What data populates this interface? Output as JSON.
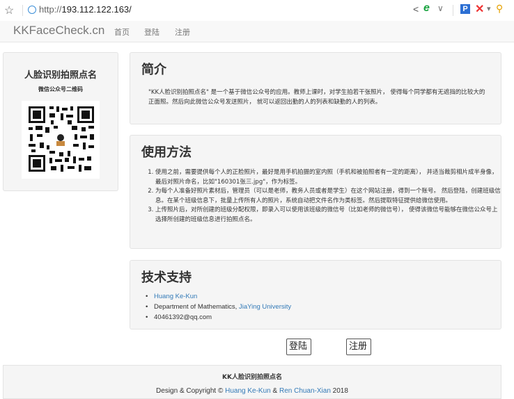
{
  "browser": {
    "url_scheme": "http://",
    "url_host": "193.112.122.163/",
    "icons": [
      "star-icon",
      "globe-icon",
      "share-icon",
      "ie-icon",
      "chevron-down-icon",
      "p-extension-icon",
      "close-icon",
      "search-icon"
    ]
  },
  "nav": {
    "brand": "KKFaceCheck.cn",
    "home": "首页",
    "login": "登陆",
    "register": "注册"
  },
  "sidebar": {
    "title": "人脸识别拍照点名",
    "subtitle": "微信公众号二维码"
  },
  "intro": {
    "heading": "简介",
    "text": "\"KK人脸识别拍照点名\" 是一个基于微信公众号的应用。教师上课时，对学生拍若干张照片， 使得每个同学都有无遮挡的比较大的正面照。然后向此微信公众号发送照片， 就可以返回出勤的人的列表和缺勤的人的列表。"
  },
  "usage": {
    "heading": "使用方法",
    "items": [
      "使用之前，需要提供每个人的正脸照片，最好是用手机拍摄的室内照（手机和被拍照者有一定的距离）， 并适当裁剪相片成半身像，最后对照片命名，比如\"160301张三.jpg\"，作为标签。",
      "为每个人准备好照片素材后，管理员（可以是老师，教务人员或者是学生）在这个网站注册，得到一个账号。 然后登陆，创建班级信息。在某个班级信息下，批量上传所有人的照片，系统自动把文件名作为类标签。然后提取特征提供给微信使用。",
      "上传照片后，对所创建的班级分配权限，即录入可以使用该班级的微信号（比如老师的微信号）， 使得该微信号能够在微信公众号上选择所创建的班级信息进行拍照点名。"
    ]
  },
  "tech": {
    "heading": "技术支持",
    "name": "Huang Ke-Kun",
    "dept_prefix": "Department of Mathematics, ",
    "university": "JiaYing University",
    "email": "40461392@qq.com"
  },
  "buttons": {
    "login": "登陆",
    "register": "注册"
  },
  "footer": {
    "title": "KK人脸识别拍照点名",
    "copy_prefix": "Design & Copyright © ",
    "author1": "Huang Ke-Kun",
    "amp": " & ",
    "author2": "Ren Chuan-Xian",
    "year": " 2018"
  },
  "colors": {
    "link": "#337ab7",
    "panel_bg": "#f5f5f5",
    "navbar_bg": "#f8f8f8"
  }
}
